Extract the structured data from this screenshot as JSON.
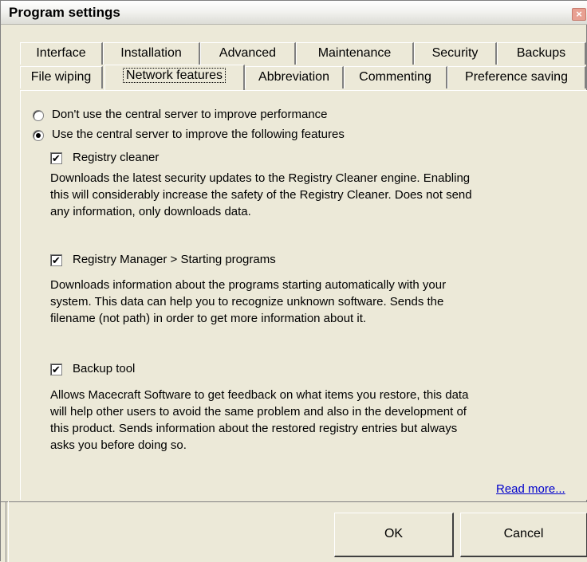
{
  "window": {
    "title": "Program settings",
    "close_glyph": "×"
  },
  "tabs": {
    "row1": [
      "Interface",
      "Installation",
      "Advanced",
      "Maintenance",
      "Security",
      "Backups"
    ],
    "row2": [
      "File wiping",
      "Network features",
      "Abbreviation",
      "Commenting",
      "Preference saving"
    ],
    "active": "Network features"
  },
  "options": {
    "radio_off": "Don't use the central server to improve performance",
    "radio_on": "Use the central server to improve the following features",
    "selected": "radio_on"
  },
  "features": [
    {
      "label": "Registry cleaner",
      "checked": true,
      "desc_lines": [
        "Downloads the latest security updates to the Registry Cleaner engine. Enabling",
        "this will considerably increase the safety of the Registry Cleaner. Does not send",
        "any information, only downloads data."
      ]
    },
    {
      "label": "Registry Manager > Starting programs",
      "checked": true,
      "desc_lines": [
        "Downloads information about the programs starting automatically with your",
        "system. This data can help you to recognize unknown software. Sends the",
        "filename (not path) in order to get more information about it."
      ]
    },
    {
      "label": "Backup tool",
      "checked": true,
      "desc_lines": [
        "Allows Macecraft Software to get feedback on what items you restore, this data",
        "will help other users to avoid the same problem and also in the development of",
        "this product. Sends information about the restored registry entries but always",
        "asks you before doing so."
      ]
    }
  ],
  "read_more": "Read more...",
  "buttons": {
    "ok": "OK",
    "cancel": "Cancel"
  },
  "check_glyph": "✔",
  "colors": {
    "face": "#ece9d8",
    "link": "#0000cc",
    "close": "#e8a092"
  }
}
